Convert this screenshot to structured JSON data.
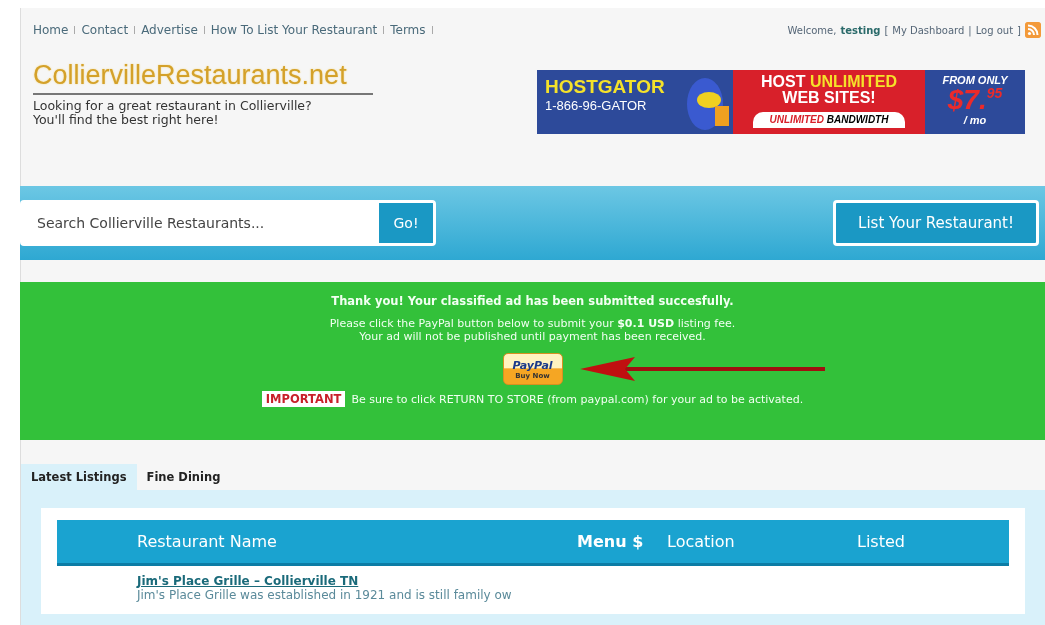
{
  "nav": [
    "Home",
    "Contact",
    "Advertise",
    "How To List Your Restaurant",
    "Terms"
  ],
  "user": {
    "welcome": "Welcome,",
    "name": "testing",
    "open_bracket": "[",
    "separator": "|",
    "links": [
      "My Dashboard",
      "Log out"
    ],
    "close_bracket": "]"
  },
  "logo": {
    "title": "ColliervilleRestaurants.net",
    "tagline": "Looking for a great restaurant in Collierville?\nYou'll find the best right here!"
  },
  "ad": {
    "brand": "HOSTGATOR",
    "phone": "1-866-96-GATOR",
    "headline_1": "HOST",
    "headline_2": "UNLIMITED",
    "headline_3": "WEB SITES!",
    "sub_1": "UNLIMITED",
    "sub_2": "BANDWIDTH",
    "from": "FROM ONLY",
    "price": "$7.",
    "cents": "95",
    "per": "/ mo"
  },
  "search": {
    "placeholder": "Search Collierville Restaurants...",
    "button": "Go!"
  },
  "list_button": "List Your Restaurant!",
  "notice": {
    "title": "Thank you! Your classified ad has been submitted succesfully.",
    "body": "Please click the PayPal button below to submit your **$0.1 USD** listing fee.\nYour ad will not be published until payment has been received.",
    "paypal_brand": "PayPal",
    "paypal_action": "Buy Now",
    "important_tag": "IMPORTANT",
    "important_text": "Be sure to click RETURN TO STORE (from paypal.com) for your ad to be activated."
  },
  "tabs": [
    {
      "label": "Latest Listings",
      "selected": true
    },
    {
      "label": "Fine Dining",
      "selected": false
    }
  ],
  "table": {
    "columns": [
      "Restaurant Name",
      "Menu $",
      "Location",
      "Listed"
    ],
    "rows": [
      {
        "title": "Jim's Place Grille – Collierville TN",
        "description": "Jim's Place Grille was established in 1921 and is still family ow"
      }
    ]
  }
}
